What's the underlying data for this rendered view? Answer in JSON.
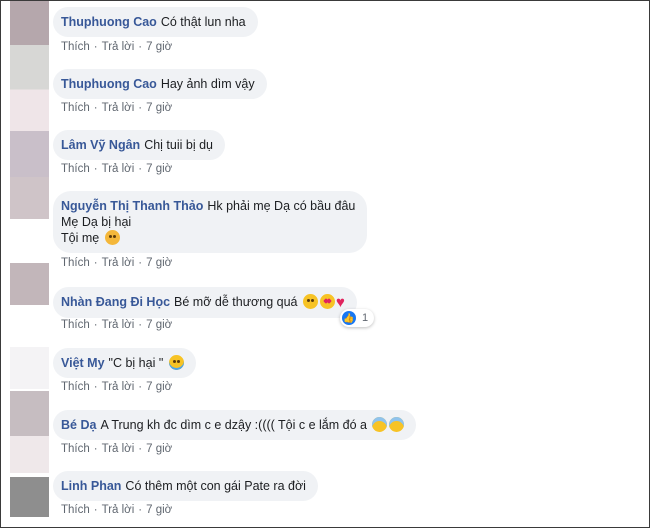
{
  "actions": {
    "like": "Thích",
    "reply": "Trả lời",
    "sep": "·"
  },
  "comments": [
    {
      "author": "Thuphuong Cao",
      "lines": [
        "Có thật lun nha"
      ],
      "time": "7 giờ",
      "avatar_color": "#b5a7ac"
    },
    {
      "author": "Thuphuong Cao",
      "lines": [
        "Hay ảnh dìm vậy"
      ],
      "time": "7 giờ",
      "avatar_color": "#d7d7d5"
    },
    {
      "author": "Lâm Vỹ Ngân",
      "lines": [
        "Chị tuii bị dụ"
      ],
      "time": "7 giờ",
      "avatar_color": "#c9bfc9"
    },
    {
      "author": "Nguyễn Thị Thanh Thảo",
      "lines": [
        "Hk phải mẹ Dạ có bầu đâu",
        "Mẹ Dạ bị hại",
        "Tội mẹ"
      ],
      "time": "7 giờ",
      "avatar_color": "#cfc4c8",
      "emoji": [
        "sad-face-emoji"
      ]
    },
    {
      "author": "Nhàn Đang Đi Học",
      "lines": [
        "Bé mỡ dễ thương quá"
      ],
      "time": "7 giờ",
      "avatar_color": "#c2b6ba",
      "emoji": [
        "kiss-face-emoji",
        "heart-eyes-emoji",
        "heart-emoji"
      ],
      "reaction_count": "1"
    },
    {
      "author": "Việt My",
      "lines": [
        "\"C bị hại \""
      ],
      "time": "7 giờ",
      "avatar_color": "#f4f3f5",
      "emoji": [
        "tears-of-joy-emoji"
      ]
    },
    {
      "author": "Bé Dạ",
      "lines": [
        "A Trung kh đc dìm c e dzậy :(((( Tội c e lắm đó a"
      ],
      "time": "7 giờ",
      "avatar_color": "#c6bdc1",
      "emoji": [
        "anxious-face-emoji",
        "anxious-face-emoji"
      ]
    },
    {
      "author": "Linh Phan",
      "lines": [
        "Có thêm một con gái Pate ra đời"
      ],
      "time": "7 giờ",
      "avatar_color": "#8e8e8e"
    }
  ]
}
